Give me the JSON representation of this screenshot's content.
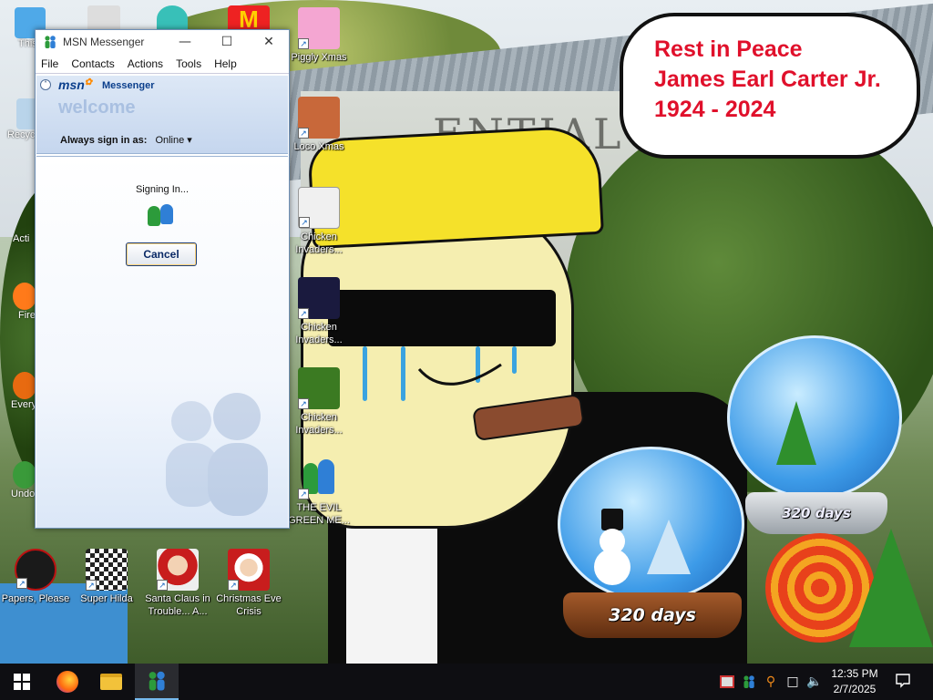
{
  "msn_window": {
    "title": "MSN Messenger",
    "menu": [
      "File",
      "Contacts",
      "Actions",
      "Tools",
      "Help"
    ],
    "logo_text": "msn",
    "product_name": "Messenger",
    "welcome": "welcome",
    "always_sign_in_label": "Always sign in as:",
    "status_value": "Online",
    "signing_in_text": "Signing In...",
    "cancel_label": "Cancel"
  },
  "speech_bubble": {
    "line1": "Rest in Peace",
    "line2": "James Earl Carter Jr.",
    "line3": "1924 - 2024"
  },
  "wallpaper_text": {
    "building": "ENTIAL",
    "globe1": "320 days",
    "globe2": "320 days"
  },
  "desktop_icons_right": [
    {
      "label": "Piggly Xmas",
      "icon": "pig-santa-icon"
    },
    {
      "label": "Loco Xmas",
      "icon": "bear-santa-icon"
    },
    {
      "label": "Chicken Invaders...",
      "icon": "chicken-invaders-icon"
    },
    {
      "label": "Chicken Invaders...",
      "icon": "chicken-invaders-icon"
    },
    {
      "label": "Chicken Invaders...",
      "icon": "chicken-invaders-icon"
    },
    {
      "label": "THE EVIL GREEN ME...",
      "icon": "msn-buddies-icon"
    }
  ],
  "desktop_icons_bottom": [
    {
      "label": "Papers, Please",
      "icon": "papers-please-icon"
    },
    {
      "label": "Super Hilda",
      "icon": "pixel-dog-icon"
    },
    {
      "label": "Santa Claus in Trouble... A...",
      "icon": "santa-icon"
    },
    {
      "label": "Christmas Eve Crisis",
      "icon": "santa-icon"
    }
  ],
  "desktop_icons_left_partial": [
    "This",
    "Recyc",
    "Acti",
    "Fire",
    "Every",
    "Undo"
  ],
  "taskbar": {
    "clock_time": "12:35 PM",
    "clock_date": "2/7/2025",
    "pinned": [
      "start-icon",
      "firefox-icon",
      "file-explorer-icon",
      "msn-messenger-icon"
    ]
  },
  "colors": {
    "bubble_text": "#e0102b",
    "msn_header": "#c5d6ee",
    "taskbar": "#0e0e12"
  }
}
